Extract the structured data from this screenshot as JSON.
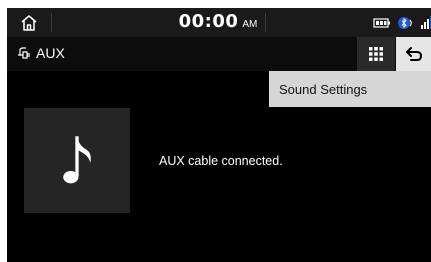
{
  "statusbar": {
    "time": "00:00",
    "ampm": "AM"
  },
  "titlebar": {
    "source_label": "AUX"
  },
  "dropdown": {
    "items": [
      {
        "label": "Sound Settings"
      }
    ]
  },
  "main": {
    "status_text": "AUX cable connected."
  },
  "icons": {
    "home": "home-icon",
    "battery": "battery-icon",
    "bluetooth": "bluetooth-icon",
    "signal": "signal-icon",
    "aux_source": "aux-plug-icon",
    "menu": "grid-menu-icon",
    "back": "back-arrow-icon",
    "music": "music-note-icon"
  },
  "colors": {
    "background": "#000000",
    "dropdown": "#d6d6d6",
    "back_button": "#e6e6e6",
    "menu_button": "#2a2a2a",
    "album_placeholder": "#252525"
  }
}
